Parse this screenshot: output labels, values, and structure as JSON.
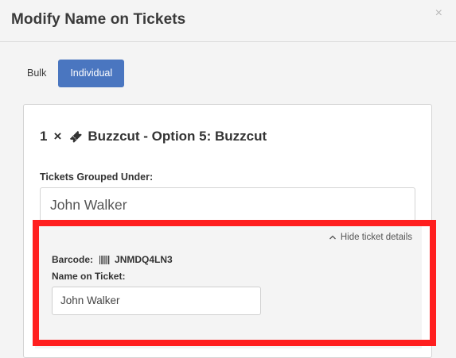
{
  "modal": {
    "title": "Modify Name on Tickets",
    "close_glyph": "×"
  },
  "tabs": [
    {
      "label": "Bulk",
      "active": false
    },
    {
      "label": "Individual",
      "active": true
    }
  ],
  "item": {
    "quantity": "1",
    "times": "×",
    "icon": "ticket-icon",
    "name": "Buzzcut - Option 5: Buzzcut"
  },
  "group": {
    "label": "Tickets Grouped Under:",
    "value": "John Walker"
  },
  "details": {
    "toggle_label": "Hide ticket details",
    "barcode_label": "Barcode:",
    "barcode_value": "JNMDQ4LN3",
    "name_label": "Name on Ticket:",
    "name_value": "John Walker"
  },
  "colors": {
    "primary": "#4a76c0",
    "highlight": "#ff1f1f"
  }
}
